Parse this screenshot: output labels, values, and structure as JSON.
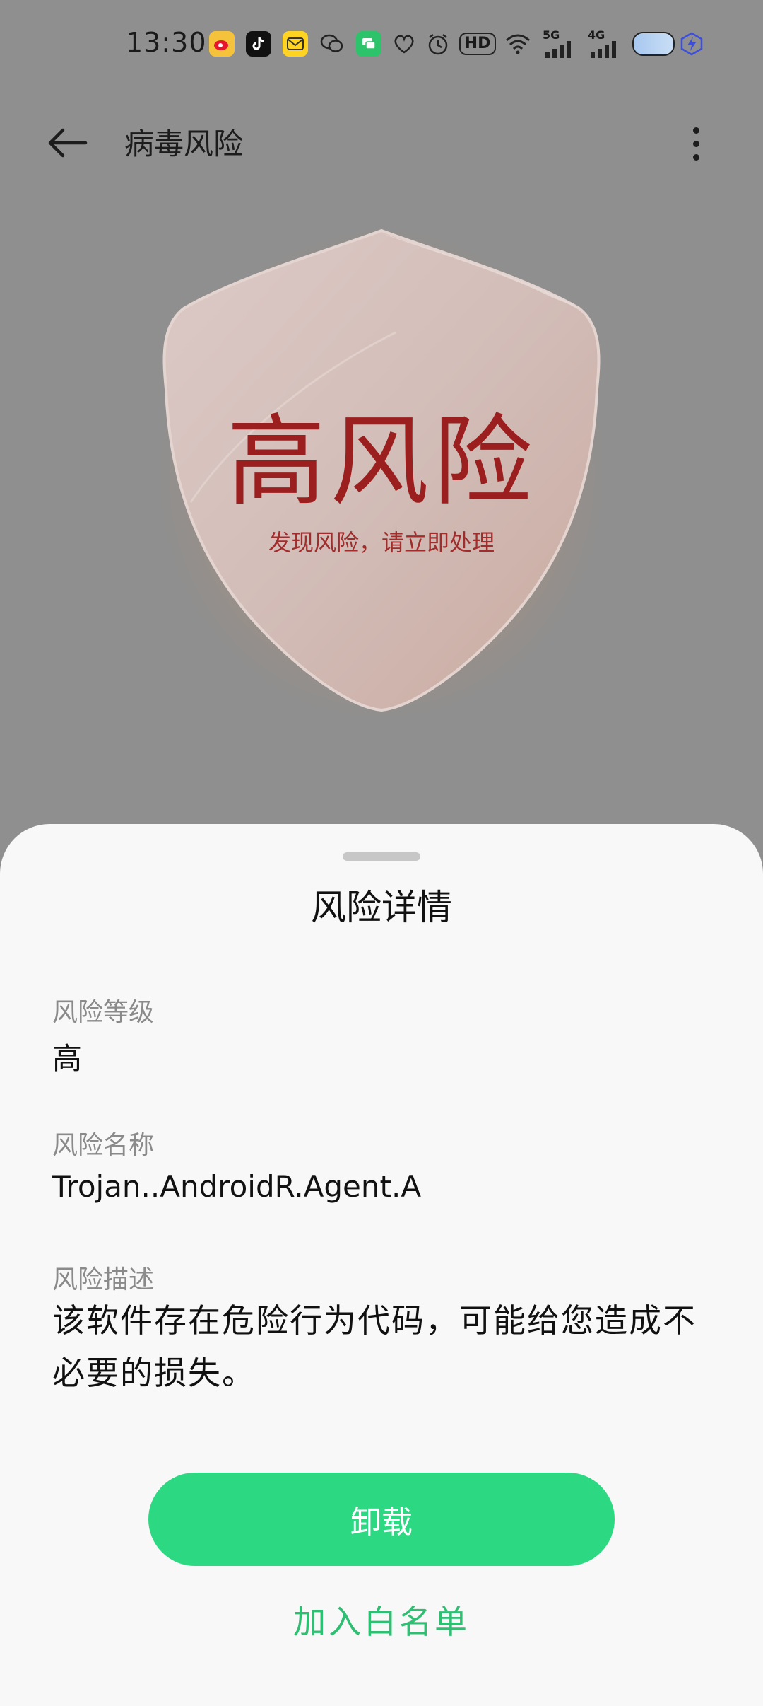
{
  "status_bar": {
    "time": "13:30",
    "network_5g": "5G",
    "network_4g": "4G",
    "hd": "HD"
  },
  "toolbar": {
    "title": "病毒风险"
  },
  "shield": {
    "level_text": "高风险",
    "subtitle": "发现风险，请立即处理"
  },
  "sheet": {
    "title": "风险详情",
    "level_label": "风险等级",
    "level_value": "高",
    "name_label": "风险名称",
    "name_value": "Trojan..AndroidR.Agent.A",
    "desc_label": "风险描述",
    "desc_value": "该软件存在危险行为代码，可能给您造成不必要的损失。",
    "uninstall_label": "卸载",
    "whitelist_label": "加入白名单"
  },
  "colors": {
    "accent": "#2dd883",
    "danger": "#9c1f1f",
    "whitelist": "#2fbf73"
  }
}
